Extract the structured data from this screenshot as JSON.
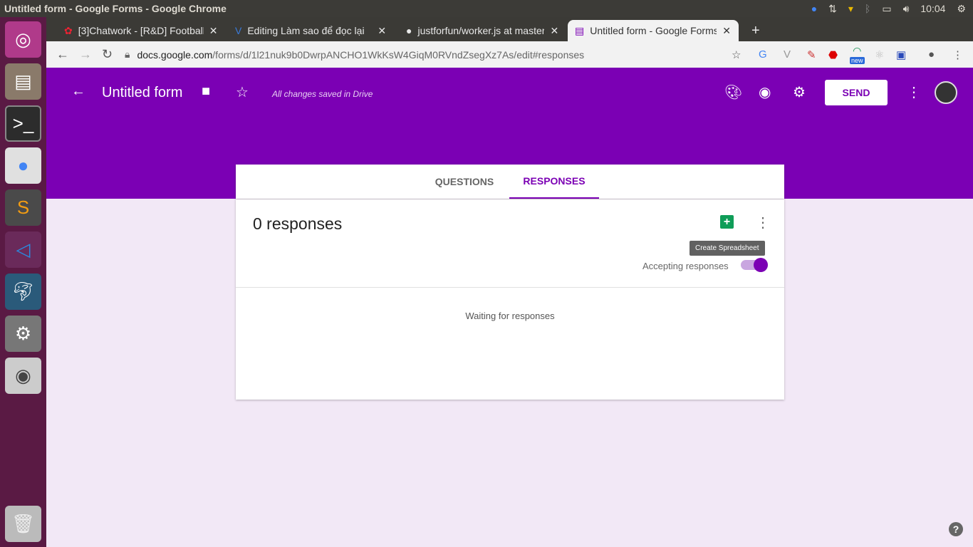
{
  "window": {
    "title": "Untitled form - Google Forms - Google Chrome",
    "clock": "10:04"
  },
  "tabs": [
    {
      "label": "[3]Chatwork - [R&D] Football"
    },
    {
      "label": "Editing Làm sao để đọc lại"
    },
    {
      "label": "justforfun/worker.js at master"
    },
    {
      "label": "Untitled form - Google Forms"
    }
  ],
  "address": {
    "host": "docs.google.com",
    "path": "/forms/d/1l21nuk9b0DwrpANCHO1WkKsW4GiqM0RVndZsegXz7As/edit#responses"
  },
  "extensions": {
    "new_badge": "new"
  },
  "form": {
    "title": "Untitled form",
    "saved": "All changes saved in Drive",
    "send": "SEND"
  },
  "form_tabs": {
    "questions": "QUESTIONS",
    "responses": "RESPONSES"
  },
  "responses": {
    "count": "0 responses",
    "tooltip": "Create Spreadsheet",
    "accepting": "Accepting responses",
    "accepting_on": true,
    "waiting": "Waiting for responses"
  },
  "colors": {
    "accent": "#7b00b4",
    "sheets": "#0f9d58"
  }
}
